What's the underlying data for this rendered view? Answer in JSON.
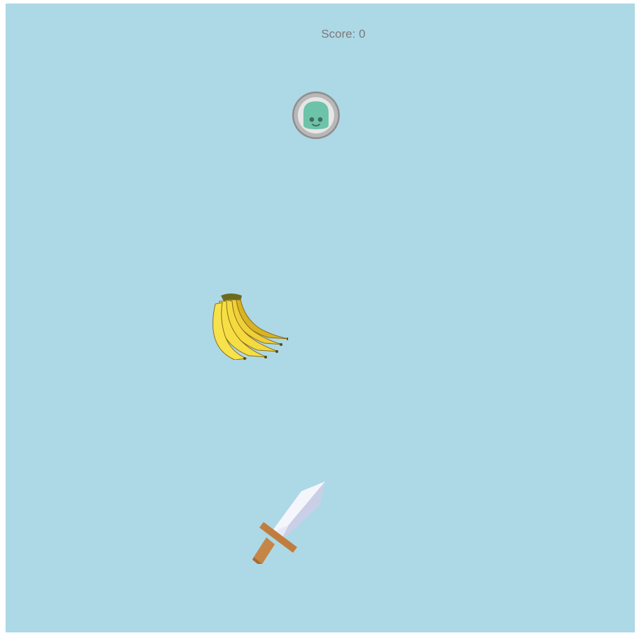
{
  "hud": {
    "score_text": "Score: 0",
    "score_value": 0
  },
  "colors": {
    "background": "#add8e6",
    "score_text": "#7a7a7a",
    "player_ring": "#b5b5b5",
    "player_body": "#6dc3a8",
    "banana": "#f2d335",
    "sword_blade": "#dfe3f3",
    "sword_hilt": "#c07d3e"
  },
  "sprites": {
    "player": "slime-in-bubble-icon",
    "fruit": "banana-bunch-icon",
    "weapon": "sword-icon"
  }
}
